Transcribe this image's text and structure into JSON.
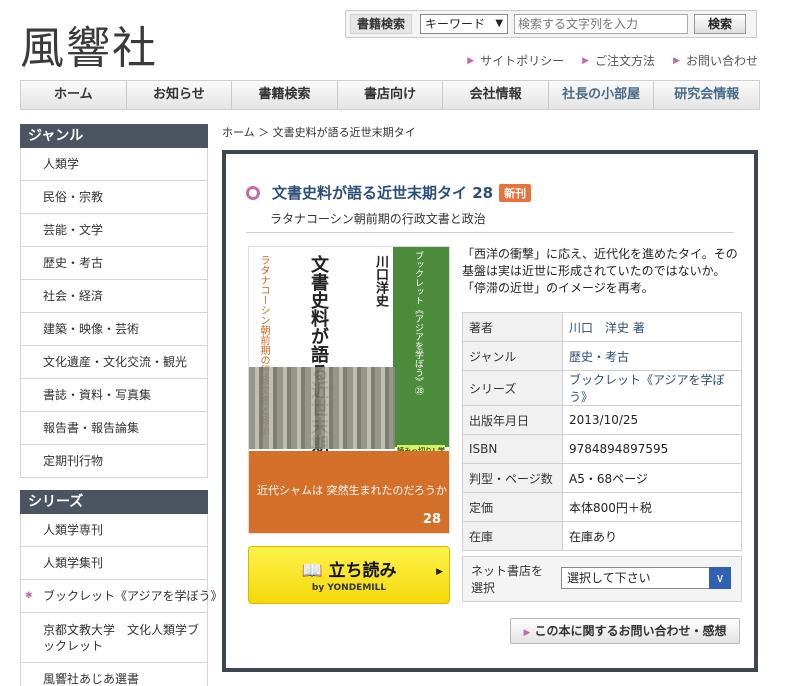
{
  "brand": {
    "logo": "風響社"
  },
  "search": {
    "title": "書籍検索",
    "select_value": "キーワード",
    "placeholder": "検索する文字列を入力",
    "button": "検索"
  },
  "util_links": [
    "サイトポリシー",
    "ご注文方法",
    "お問い合わせ"
  ],
  "nav": [
    "ホーム",
    "お知らせ",
    "書籍検索",
    "書店向け",
    "会社情報",
    "社長の小部屋",
    "研究会情報"
  ],
  "sidebar": {
    "genre_title": "ジャンル",
    "genres": [
      "人類学",
      "民俗・宗教",
      "芸能・文学",
      "歴史・考古",
      "社会・経済",
      "建築・映像・芸術",
      "文化遺産・文化交流・観光",
      "書誌・資料・写真集",
      "報告書・報告論集",
      "定期刊行物"
    ],
    "series_title": "シリーズ",
    "series": [
      "人類学専刊",
      "人類学集刊",
      "ブックレット《アジアを学ぼう》",
      "京都文教大学　文化人類学ブックレット",
      "風響社あじあ選書"
    ]
  },
  "breadcrumb": "ホーム ＞ 文書史料が語る近世末期タイ",
  "book": {
    "title": "文書史料が語る近世末期タイ 28",
    "badge": "新刊",
    "subtitle": "ラタナコーシン朝前期の行政文書と政治",
    "description": "「西洋の衝撃」に応え、近代化を進めたタイ。その基盤は実は近世に形成されていたのではないか。「停滞の近世」のイメージを再考。",
    "info": [
      {
        "label": "著者",
        "value": "川口　洋史 著"
      },
      {
        "label": "ジャンル",
        "value": "歴史・考古"
      },
      {
        "label": "シリーズ",
        "value": "ブックレット《アジアを学ぼう》"
      },
      {
        "label": "出版年月日",
        "value": "2013/10/25"
      },
      {
        "label": "ISBN",
        "value": "9784894897595"
      },
      {
        "label": "判型・ページ数",
        "value": "A5・68ページ"
      },
      {
        "label": "定価",
        "value": "本体800円＋税"
      },
      {
        "label": "在庫",
        "value": "在庫あり"
      }
    ],
    "cover": {
      "title": "文書史料が語る近世末期タイ",
      "subtitle": "ラタナコーシン朝前期の行政文書と政治",
      "author": "川口洋史",
      "series": "ブックレット《アジアを学ぼう》㉘",
      "badge": "読みっ切り! 学術最前線",
      "catch": "近代シャムは 突然生まれたのだろうか",
      "number": "28"
    },
    "tachiyomi_main": "立ち読み",
    "tachiyomi_sub": "by YONDEMILL",
    "shop_label": "ネット書店を選択",
    "shop_select": "選択して下さい",
    "inquiry": "この本に関するお問い合わせ・感想"
  }
}
